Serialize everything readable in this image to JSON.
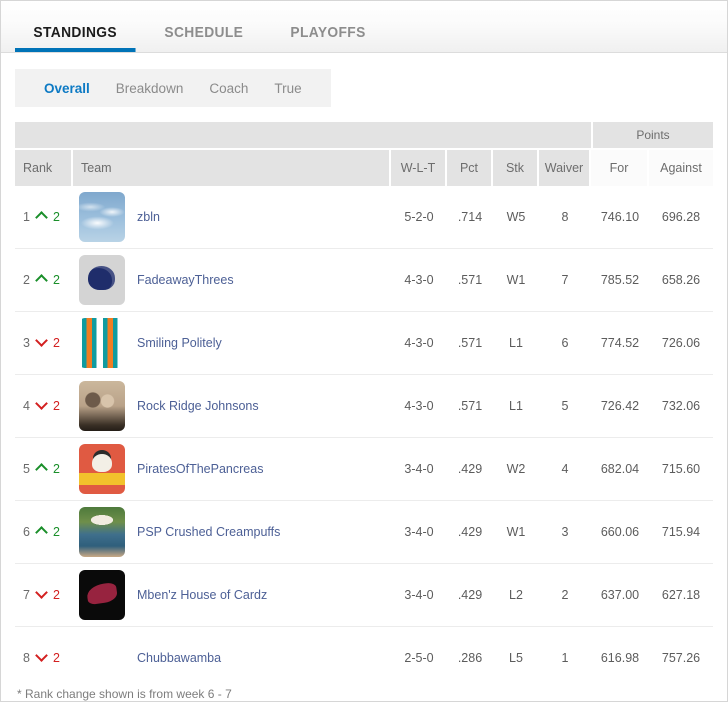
{
  "tabs": [
    {
      "label": "STANDINGS",
      "active": true
    },
    {
      "label": "SCHEDULE",
      "active": false
    },
    {
      "label": "PLAYOFFS",
      "active": false
    }
  ],
  "subtabs": [
    {
      "label": "Overall",
      "active": true
    },
    {
      "label": "Breakdown",
      "active": false
    },
    {
      "label": "Coach",
      "active": false
    },
    {
      "label": "True",
      "active": false
    }
  ],
  "table": {
    "group_header": {
      "points": "Points"
    },
    "columns": {
      "rank": "Rank",
      "team": "Team",
      "record": "W-L-T",
      "pct": "Pct",
      "streak": "Stk",
      "waiver": "Waiver",
      "points_for": "For",
      "points_against": "Against"
    },
    "rows": [
      {
        "rank": "1",
        "direction": "up",
        "delta": "2",
        "avatar": "av-sky",
        "avatar_name": "sky-clouds-avatar",
        "team": "zbln",
        "record": "5-2-0",
        "pct": ".714",
        "streak": "W5",
        "waiver": "8",
        "points_for": "746.10",
        "points_against": "696.28"
      },
      {
        "rank": "2",
        "direction": "up",
        "delta": "2",
        "avatar": "av-helmet",
        "avatar_name": "nfl-helmet-avatar",
        "team": "FadeawayThrees",
        "record": "4-3-0",
        "pct": ".571",
        "streak": "W1",
        "waiver": "7",
        "points_for": "785.52",
        "points_against": "658.26"
      },
      {
        "rank": "3",
        "direction": "down",
        "delta": "2",
        "avatar": "av-stripes",
        "avatar_name": "striped-avatar",
        "team": "Smiling Politely",
        "record": "4-3-0",
        "pct": ".571",
        "streak": "L1",
        "waiver": "6",
        "points_for": "774.52",
        "points_against": "726.06"
      },
      {
        "rank": "4",
        "direction": "down",
        "delta": "2",
        "avatar": "av-photo1",
        "avatar_name": "portrait-avatar",
        "team": "Rock Ridge Johnsons",
        "record": "4-3-0",
        "pct": ".571",
        "streak": "L1",
        "waiver": "5",
        "points_for": "726.42",
        "points_against": "732.06"
      },
      {
        "rank": "5",
        "direction": "up",
        "delta": "2",
        "avatar": "av-pirate",
        "avatar_name": "pirate-skull-avatar",
        "team": "PiratesOfThePancreas",
        "record": "3-4-0",
        "pct": ".429",
        "streak": "W2",
        "waiver": "4",
        "points_for": "682.04",
        "points_against": "715.60"
      },
      {
        "rank": "6",
        "direction": "up",
        "delta": "2",
        "avatar": "av-beach",
        "avatar_name": "beach-photo-avatar",
        "team": "PSP Crushed Creampuffs",
        "record": "3-4-0",
        "pct": ".429",
        "streak": "W1",
        "waiver": "3",
        "points_for": "660.06",
        "points_against": "715.94"
      },
      {
        "rank": "7",
        "direction": "down",
        "delta": "2",
        "avatar": "av-cards",
        "avatar_name": "cardinals-logo-avatar",
        "team": "Mben'z House of Cardz",
        "record": "3-4-0",
        "pct": ".429",
        "streak": "L2",
        "waiver": "2",
        "points_for": "637.00",
        "points_against": "627.18"
      },
      {
        "rank": "8",
        "direction": "down",
        "delta": "2",
        "avatar": "av-person",
        "avatar_name": "person-photo-avatar",
        "team": "Chubbawamba",
        "record": "2-5-0",
        "pct": ".286",
        "streak": "L5",
        "waiver": "1",
        "points_for": "616.98",
        "points_against": "757.26"
      }
    ]
  },
  "footnote": "* Rank change shown is from week 6 - 7",
  "colors": {
    "accent_blue": "#0073b7",
    "link_blue": "#4d6096",
    "up_green": "#1a8f2a",
    "down_red": "#d32020"
  }
}
